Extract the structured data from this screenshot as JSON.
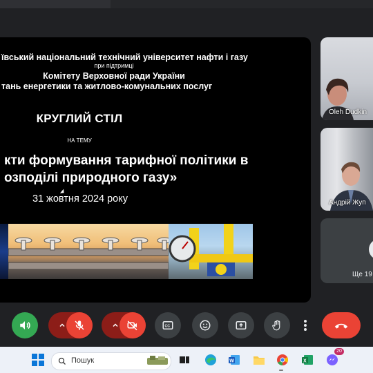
{
  "slide": {
    "university": "ївський національний технічний університет нафти і газу",
    "support": "при підтримці",
    "committee": "Комітету Верховної ради України",
    "committee_topic": "тань енергетики та житлово-комунальних послуг",
    "event": "КРУГЛИЙ СТІЛ",
    "subject_prefix": "НА ТЕМУ",
    "subject_line1": "кти формування тарифної політики в",
    "subject_line2": "озподілі природного газу»",
    "date": "31 жовтня 2024 року"
  },
  "participants": [
    {
      "name": "Oleh Dudkin"
    },
    {
      "name": "Андрій Жуп"
    }
  ],
  "more_participants": "Ще 19",
  "controls": {
    "speaker": "speaker-icon",
    "mic_arrow": "chevron-up-icon",
    "mic": "mic-off-icon",
    "cam_arrow": "chevron-up-icon",
    "camera": "camera-off-icon",
    "captions": "captions-icon",
    "emoji": "emoji-icon",
    "present": "present-icon",
    "raise_hand": "hand-icon",
    "more": "more-vert-icon",
    "leave": "end-call-icon",
    "leave_color": "#ea4335"
  },
  "taskbar": {
    "search_placeholder": "Пошук",
    "badge_count": "20"
  }
}
